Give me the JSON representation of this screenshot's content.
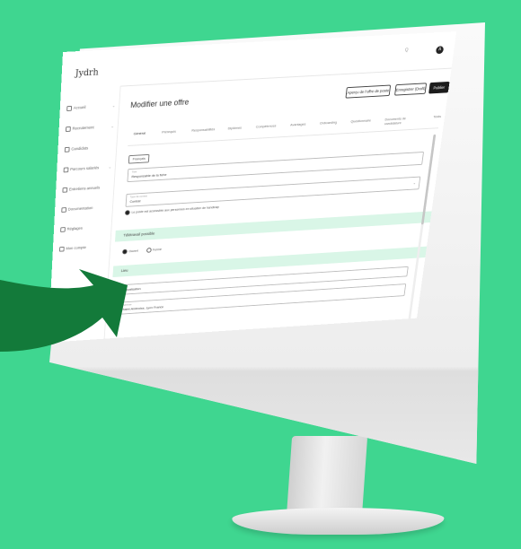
{
  "colors": {
    "background": "#3fd690",
    "arrow": "#137a3a",
    "section": "#d9f6e7",
    "primary_button": "#1c1c1c"
  },
  "app": {
    "logo": "Jydrh",
    "search_hint": "Q",
    "avatar_initial": "A"
  },
  "sidebar": {
    "items": [
      {
        "label": "Accueil",
        "icon": "home-icon",
        "has_chevron": true
      },
      {
        "label": "Recrutement",
        "icon": "briefcase-icon",
        "has_chevron": true
      },
      {
        "label": "Candidats",
        "icon": "users-icon",
        "has_chevron": false
      },
      {
        "label": "Parcours salariés",
        "icon": "route-icon",
        "has_chevron": true
      },
      {
        "label": "Entretiens annuels",
        "icon": "calendar-icon",
        "has_chevron": false
      },
      {
        "label": "Documentation",
        "icon": "document-icon",
        "has_chevron": false
      },
      {
        "label": "Réglages",
        "icon": "gear-icon",
        "has_chevron": false
      },
      {
        "label": "Mon compte",
        "icon": "user-icon",
        "has_chevron": false
      }
    ]
  },
  "page": {
    "title": "Modifier une offre",
    "buttons": {
      "preview": "Aperçu de l'offre de poste",
      "save_draft": "Enregistrer (Draft)",
      "publish": "Publier"
    }
  },
  "tabs": [
    "Général",
    "Prérequis",
    "Responsabilités",
    "Diplômes",
    "Compétences",
    "Avantages",
    "Onboarding",
    "Questionnaire",
    "Documents de candidature",
    "Tests"
  ],
  "form": {
    "chip": "Français",
    "title_field": {
      "label": "Titre",
      "value": "Responsable de la fiche"
    },
    "type_field": {
      "label": "Type de contrat",
      "value": "Contrat"
    },
    "info_note": "Le poste est accessible aux personnes en situation de handicap",
    "section_1": "Télétravail possible",
    "radios": [
      {
        "label": "Ouvert",
        "checked": true
      },
      {
        "label": "Fermé",
        "checked": false
      }
    ],
    "section_2": "Lieu",
    "location_label": "Localisation",
    "address_field": {
      "label": "Adresse",
      "value": "Saint-Ambroise, Lyon France"
    }
  }
}
